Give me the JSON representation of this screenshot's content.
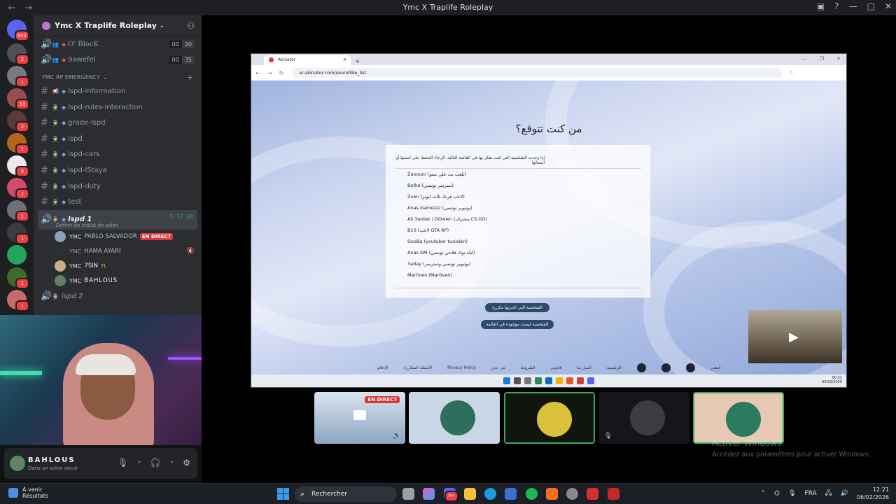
{
  "window": {
    "title": "Ymc X Traplife Roleplay"
  },
  "rail": {
    "home_badge": "902",
    "badges": [
      "2",
      "1",
      "10",
      "2",
      "1",
      "9",
      "2",
      "1",
      "1",
      "1",
      "1"
    ]
  },
  "guild": {
    "name": "Ymc X Traplife Roleplay"
  },
  "voice_top": [
    {
      "name": "O' BlocK",
      "count_a": "00",
      "count_b": "20"
    },
    {
      "name": "9awefel",
      "count_a": "00",
      "count_b": "35"
    }
  ],
  "category": {
    "label": "YMC RP EMERGENCY"
  },
  "channels": [
    "lspd-information",
    "lspd-rules-interaction",
    "grade-lspd",
    "lspd",
    "lspd-cars",
    "lspd-l5taya",
    "lspd-duty",
    "test"
  ],
  "voice_active": {
    "name": "lspd 1",
    "time": "5:37:08",
    "status_hint": "Définir un statut de salon"
  },
  "members": [
    {
      "tag": "YMC",
      "name": "PABLO SALVADOR",
      "live": "EN DIRECT"
    },
    {
      "tag": "YMC",
      "name": "HAMA AYARI"
    },
    {
      "tag": "YMC",
      "name": "7SIN",
      "extra": "TL"
    },
    {
      "tag": "YMC",
      "name": "BAHLOUS"
    }
  ],
  "voice_next": {
    "name": "lspd 2"
  },
  "user": {
    "name": "BAHLOUS",
    "status": "Dans un salon vocal"
  },
  "browser": {
    "tab": "Akinator",
    "url": "ar.akinator.com/soundlike_list",
    "page_title": "من كنت تتوقع؟",
    "intro": "إذا وجدت الشخصية التي كنت تفكر بها في القائمة التالية، الرجاء الضغط على اسمها أو أسمائها",
    "items": [
      "Zanouni (يلعب بث على تيمو)",
      "Belha (ستريمر تونسي)",
      "Zven (لاعب فرنك ثلاث ايونز)",
      "Anas Gamezzz (يوتيوبر تونسي)",
      "Ali 3ardak / DOwwn (محترف CS:GO)",
      "B10 (لاعب GTA RP)",
      "GooBa (youtuber tunisien)",
      "Anas GM (لباه توك فلاحي تونسي)",
      "3aday (يوتيوبر تونسي وستريمر)",
      "Mar0ven (Mar0ven)"
    ],
    "btn_primary": "الشخصية التي اخترتها مكررة",
    "btn_secondary": "الشخصية ليست موجودة في القائمة",
    "footer": [
      "الإعلام",
      "الأسئلة المتكررة",
      "Privacy Policy",
      "من نحن",
      "الشروط",
      "قانوني",
      "اتصل بنا",
      "الرئيسية",
      "اتبعني"
    ],
    "clock_time": "00:21",
    "clock_date": "06/02/2026"
  },
  "tiles": {
    "live_label": "EN DIRECT"
  },
  "activation": {
    "line1": "Activer Windows",
    "line2": "Accédez aux paramètres pour activer Windows."
  },
  "taskbar": {
    "weather_line1": "À venir",
    "weather_line2": "Résultats",
    "search_placeholder": "Rechercher",
    "discord_badge": "9+",
    "lang": "FRA",
    "time": "12:21",
    "date": "06/02/2026"
  }
}
